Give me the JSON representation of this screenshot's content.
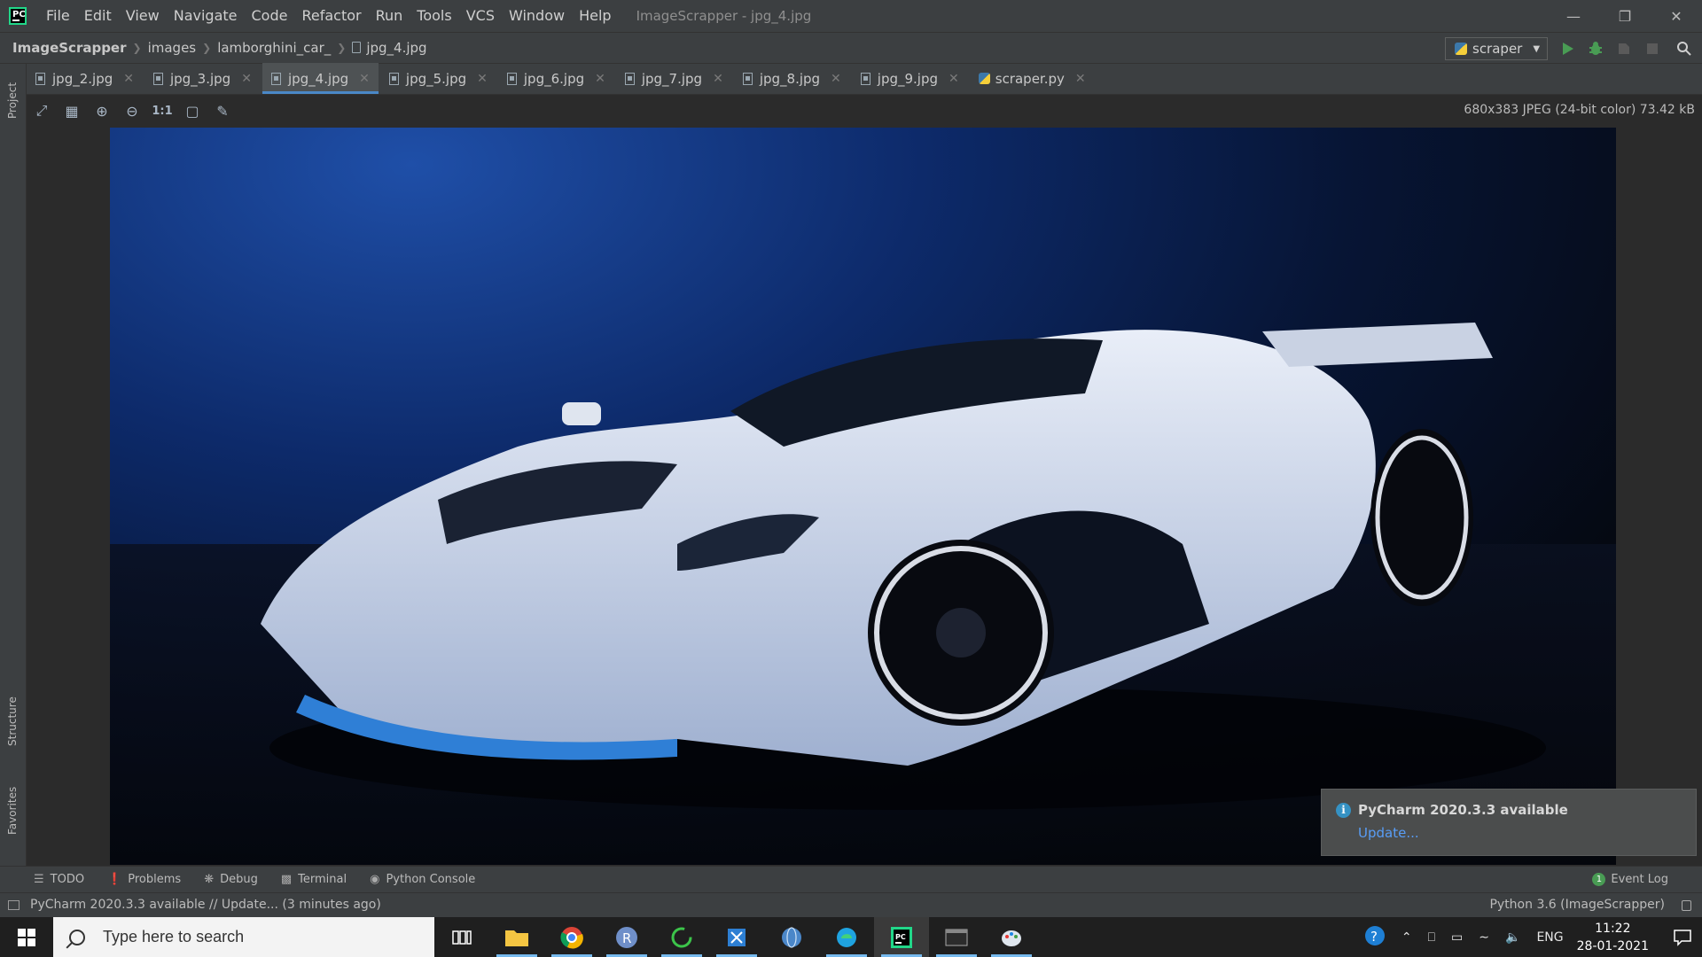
{
  "menu": [
    "File",
    "Edit",
    "View",
    "Navigate",
    "Code",
    "Refactor",
    "Run",
    "Tools",
    "VCS",
    "Window",
    "Help"
  ],
  "window_title": "ImageScrapper - jpg_4.jpg",
  "breadcrumb": {
    "project": "ImageScrapper",
    "folder1": "images",
    "folder2": "lamborghini_car_",
    "file": "jpg_4.jpg"
  },
  "run_config": "scraper",
  "tabs": [
    {
      "label": "jpg_2.jpg",
      "active": false
    },
    {
      "label": "jpg_3.jpg",
      "active": false
    },
    {
      "label": "jpg_4.jpg",
      "active": true
    },
    {
      "label": "jpg_5.jpg",
      "active": false
    },
    {
      "label": "jpg_6.jpg",
      "active": false
    },
    {
      "label": "jpg_7.jpg",
      "active": false
    },
    {
      "label": "jpg_8.jpg",
      "active": false
    },
    {
      "label": "jpg_9.jpg",
      "active": false
    },
    {
      "label": "scraper.py",
      "active": false
    }
  ],
  "left_stripe": {
    "project": "Project",
    "structure": "Structure",
    "favorites": "Favorites"
  },
  "image_info": "680x383 JPEG (24-bit color) 73.42 kB",
  "image_toolbar": {
    "actual_size": "1:1"
  },
  "notification": {
    "title": "PyCharm 2020.3.3 available",
    "link": "Update..."
  },
  "tool_windows": {
    "todo": "TODO",
    "problems": "Problems",
    "debug": "Debug",
    "terminal": "Terminal",
    "python_console": "Python Console",
    "event_log": "Event Log",
    "event_count": "1"
  },
  "status": {
    "message": "PyCharm 2020.3.3 available // Update... (3 minutes ago)",
    "interpreter": "Python 3.6 (ImageScrapper)"
  },
  "taskbar": {
    "search_placeholder": "Type here to search",
    "tray_lang": "ENG",
    "time": "11:22",
    "date": "28-01-2021"
  },
  "colors": {
    "accent": "#4a88c7",
    "link": "#589df6",
    "ide_bg": "#2b2b2b",
    "panel_bg": "#3c3f41"
  }
}
